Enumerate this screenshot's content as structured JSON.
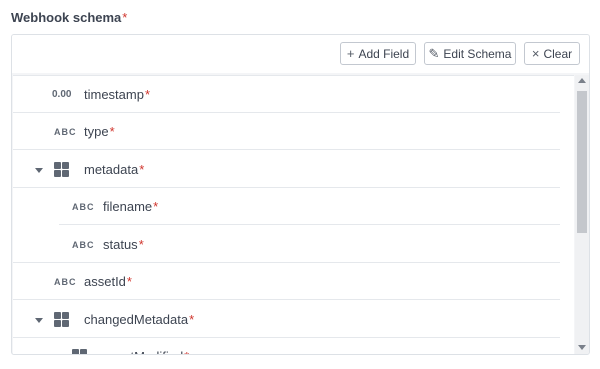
{
  "field": {
    "label": "Webhook schema",
    "required_mark": "*"
  },
  "toolbar": {
    "add_label": "Add Field",
    "add_icon": "plus-icon",
    "edit_label": "Edit Schema",
    "edit_icon": "pencil-icon",
    "clear_label": "Clear",
    "clear_icon": "x-icon"
  },
  "rows": [
    {
      "type_label": "0.00",
      "name": "timestamp",
      "required": "*"
    },
    {
      "type_label": "ABC",
      "name": "type",
      "required": "*"
    },
    {
      "type_label": "",
      "name": "metadata",
      "required": "*",
      "icon": "object-grid-icon",
      "expanded": true
    },
    {
      "type_label": "ABC",
      "name": "filename",
      "required": "*",
      "child": true
    },
    {
      "type_label": "ABC",
      "name": "status",
      "required": "*",
      "child": true
    },
    {
      "type_label": "ABC",
      "name": "assetId",
      "required": "*"
    },
    {
      "type_label": "",
      "name": "changedMetadata",
      "required": "*",
      "icon": "object-grid-icon",
      "expanded": true
    },
    {
      "type_label": "",
      "name": "assetModified",
      "required": "*",
      "icon": "object-grid-icon",
      "child": true
    }
  ],
  "colors": {
    "required": "#d0342c",
    "text": "#3d4451",
    "icon": "#5f6773",
    "border": "#e5e8ec"
  }
}
